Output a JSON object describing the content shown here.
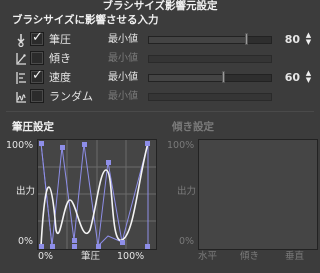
{
  "window_title": "ブラシサイズ影響元設定",
  "section_input": "ブラシサイズに影響させる入力",
  "rows": [
    {
      "label": "筆圧",
      "checked": true,
      "icon": "pen-pressure-icon",
      "min_label": "最小値",
      "value": "80",
      "level_percent": 80,
      "enabled": true
    },
    {
      "label": "傾き",
      "checked": false,
      "icon": "tilt-icon",
      "min_label": "最小値",
      "value": "",
      "enabled": false
    },
    {
      "label": "速度",
      "checked": true,
      "icon": "velocity-icon",
      "min_label": "最小値",
      "value": "60",
      "level_percent": 60,
      "enabled": true
    },
    {
      "label": "ランダム",
      "checked": false,
      "icon": "random-icon",
      "min_label": "最小値",
      "value": "",
      "enabled": false
    }
  ],
  "pressure_graph": {
    "title": "筆圧設定",
    "y_top": "100%",
    "y_mid": "出力",
    "y_bottom": "0%",
    "x_left": "0%",
    "x_mid": "筆圧",
    "x_right": "100%"
  },
  "tilt_graph": {
    "title": "傾き設定",
    "y_top": "100%",
    "y_mid": "出力",
    "y_bottom": "0%",
    "x_left": "水平",
    "x_mid": "傾き",
    "x_right": "垂直"
  },
  "icons": {
    "spin_up": "▲",
    "spin_down": "▼",
    "check": "✓"
  }
}
